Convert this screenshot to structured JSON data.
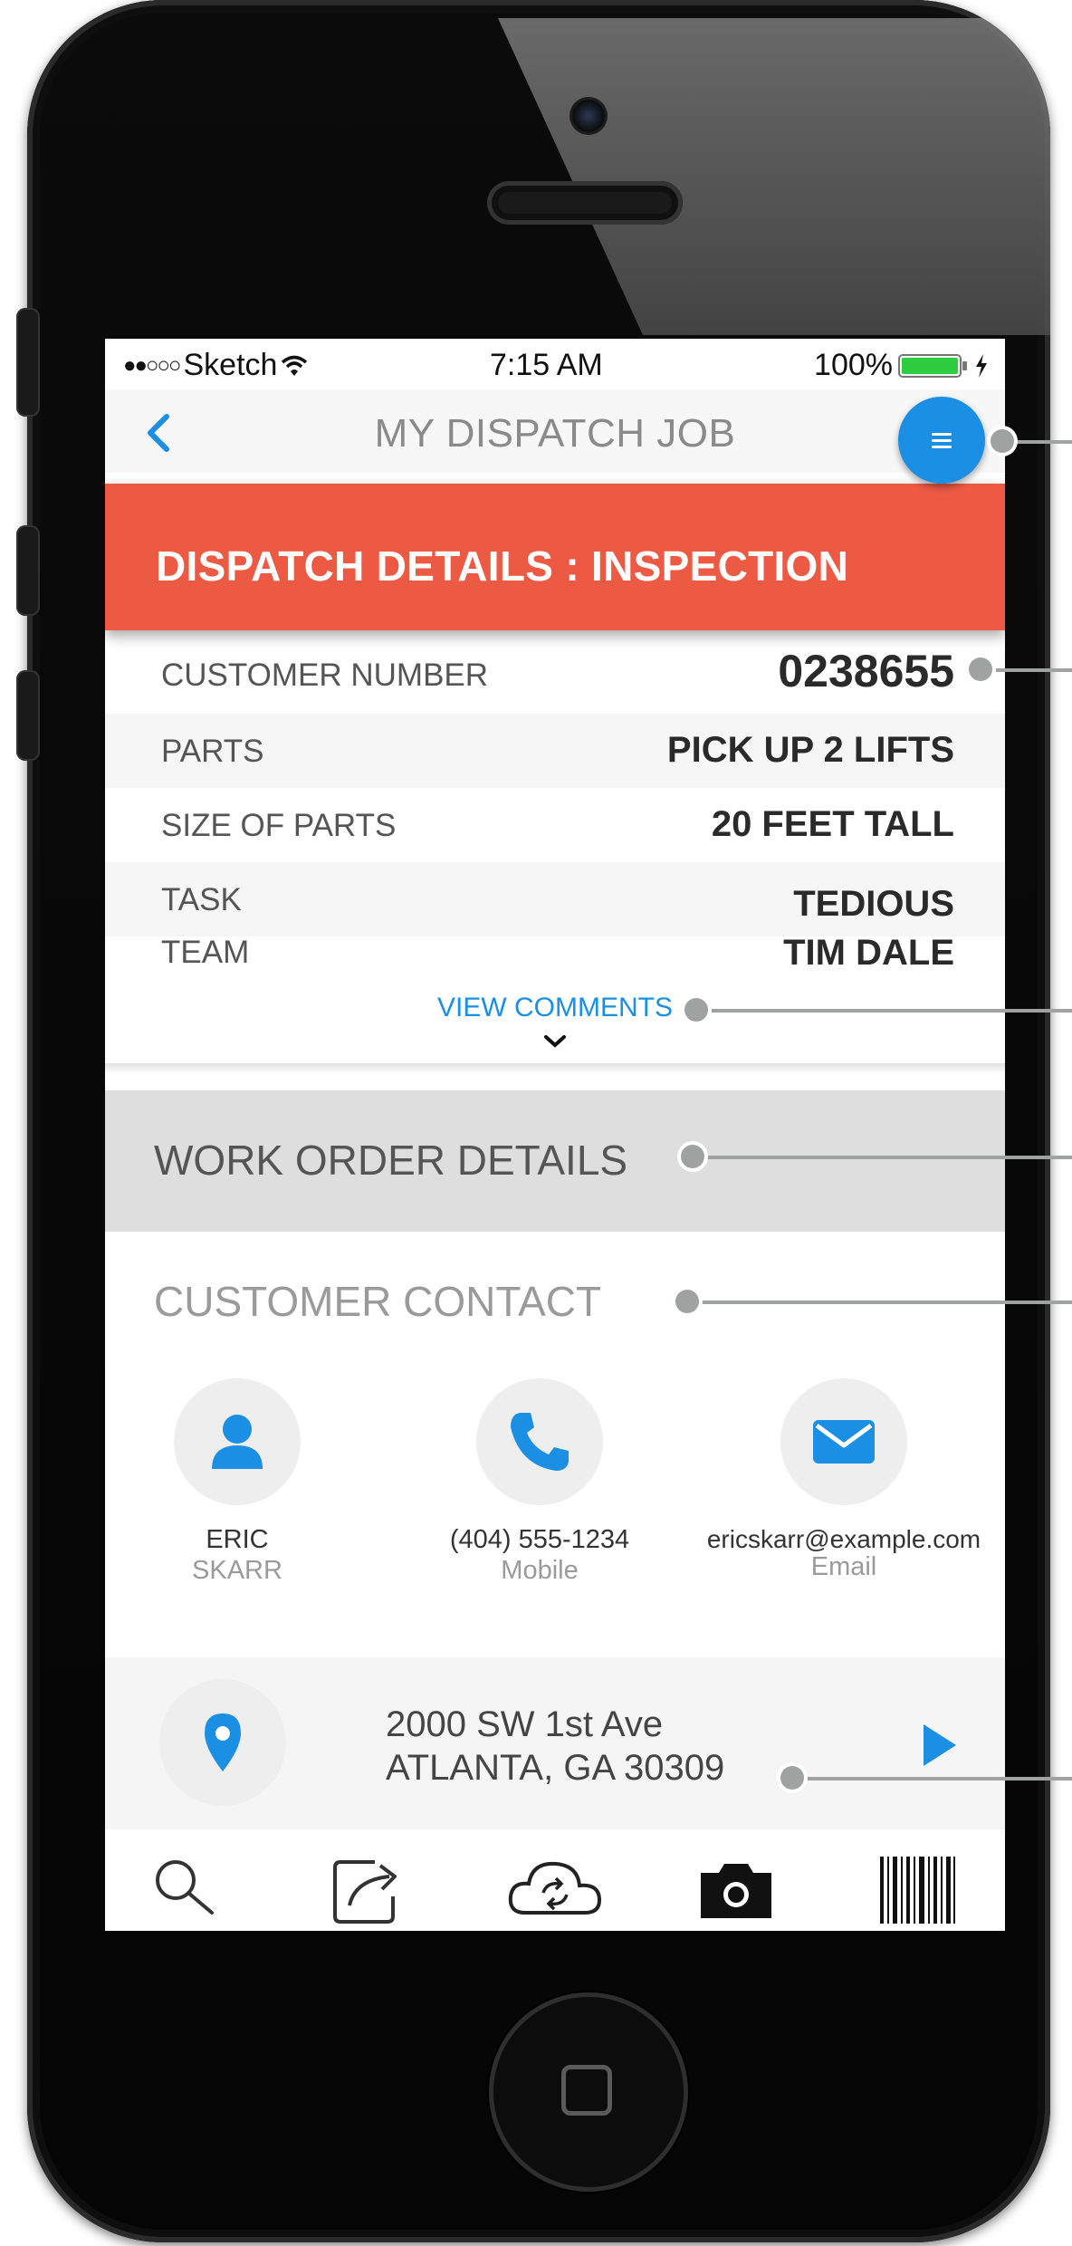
{
  "status_bar": {
    "carrier": "Sketch",
    "time": "7:15 AM",
    "battery": "100%"
  },
  "nav": {
    "title": "MY DISPATCH JOB",
    "back_icon": "chevron-left-icon",
    "menu_icon": "hamburger-menu-icon"
  },
  "banner": {
    "title": "DISPATCH DETAILS : INSPECTION"
  },
  "details": [
    {
      "label": "CUSTOMER NUMBER",
      "value": "0238655"
    },
    {
      "label": "PARTS",
      "value": "PICK UP 2 LIFTS"
    },
    {
      "label": "SIZE OF PARTS",
      "value": "20 FEET TALL"
    },
    {
      "label": "TASK",
      "value": "TEDIOUS"
    },
    {
      "label": "TEAM",
      "value": "TIM  DALE"
    }
  ],
  "view_comments": "VIEW COMMENTS",
  "work_order": {
    "title": "WORK ORDER DETAILS"
  },
  "contact": {
    "title": "CUSTOMER CONTACT",
    "person": {
      "first": "ERIC",
      "last": "SKARR"
    },
    "phone": {
      "number": "(404) 555-1234",
      "type": "Mobile"
    },
    "email": {
      "address": "ericskarr@example.com",
      "type": "Email"
    }
  },
  "address": {
    "line1": "2000 SW 1st Ave",
    "line2": "ATLANTA, GA 30309"
  },
  "toolbar": [
    "search-icon",
    "share-icon",
    "cloud-sync-icon",
    "camera-icon",
    "barcode-icon"
  ],
  "colors": {
    "accent": "#1a8fe3",
    "banner": "#ec5a44",
    "battery": "#2ecc40"
  }
}
